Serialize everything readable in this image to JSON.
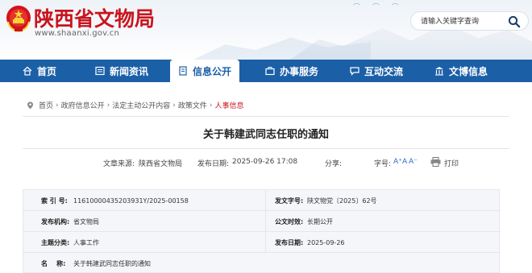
{
  "header": {
    "title": "陕西省文物局",
    "url": "www.shaanxi.gov.cn",
    "search_placeholder": "请输入关键字查询"
  },
  "nav": [
    {
      "label": "首页",
      "icon": "home-icon"
    },
    {
      "label": "新闻资讯",
      "icon": "news-icon"
    },
    {
      "label": "信息公开",
      "icon": "document-icon",
      "active": true
    },
    {
      "label": "办事服务",
      "icon": "briefcase-icon"
    },
    {
      "label": "互动交流",
      "icon": "chat-icon"
    },
    {
      "label": "文博信息",
      "icon": "museum-icon"
    }
  ],
  "breadcrumb": [
    "首页",
    "政府信息公开",
    "法定主动公开内容",
    "政策文件",
    "人事信息"
  ],
  "breadcrumb_sep": "›",
  "article": {
    "title": "关于韩建武同志任职的通知",
    "source_label": "文章来源:",
    "source": "陕西省文物局",
    "date_label": "发布日期:",
    "date": "2025-09-26 17:08",
    "share_label": "分享:",
    "font_label": "字号:",
    "font_large": "A⁺",
    "font_mid": "A",
    "font_small": "A⁻",
    "print_label": "打印"
  },
  "info": {
    "index_label": "索 引 号:",
    "index": "11610000435203931Y/2025-00158",
    "docno_label": "发文字号:",
    "docno": "陕文物党〔2025〕62号",
    "org_label": "发布机构:",
    "org": "省文物局",
    "period_label": "公文时效:",
    "period": "长期公开",
    "topic_label": "主题分类:",
    "topic": "人事工作",
    "pubdate_label": "发布日期:",
    "pubdate": "2025-09-26",
    "name_label": "名    称:",
    "name": "关于韩建武同志任职的通知"
  },
  "colors": {
    "brand_red": "#c9151e",
    "nav_blue": "#1b5fa7"
  }
}
